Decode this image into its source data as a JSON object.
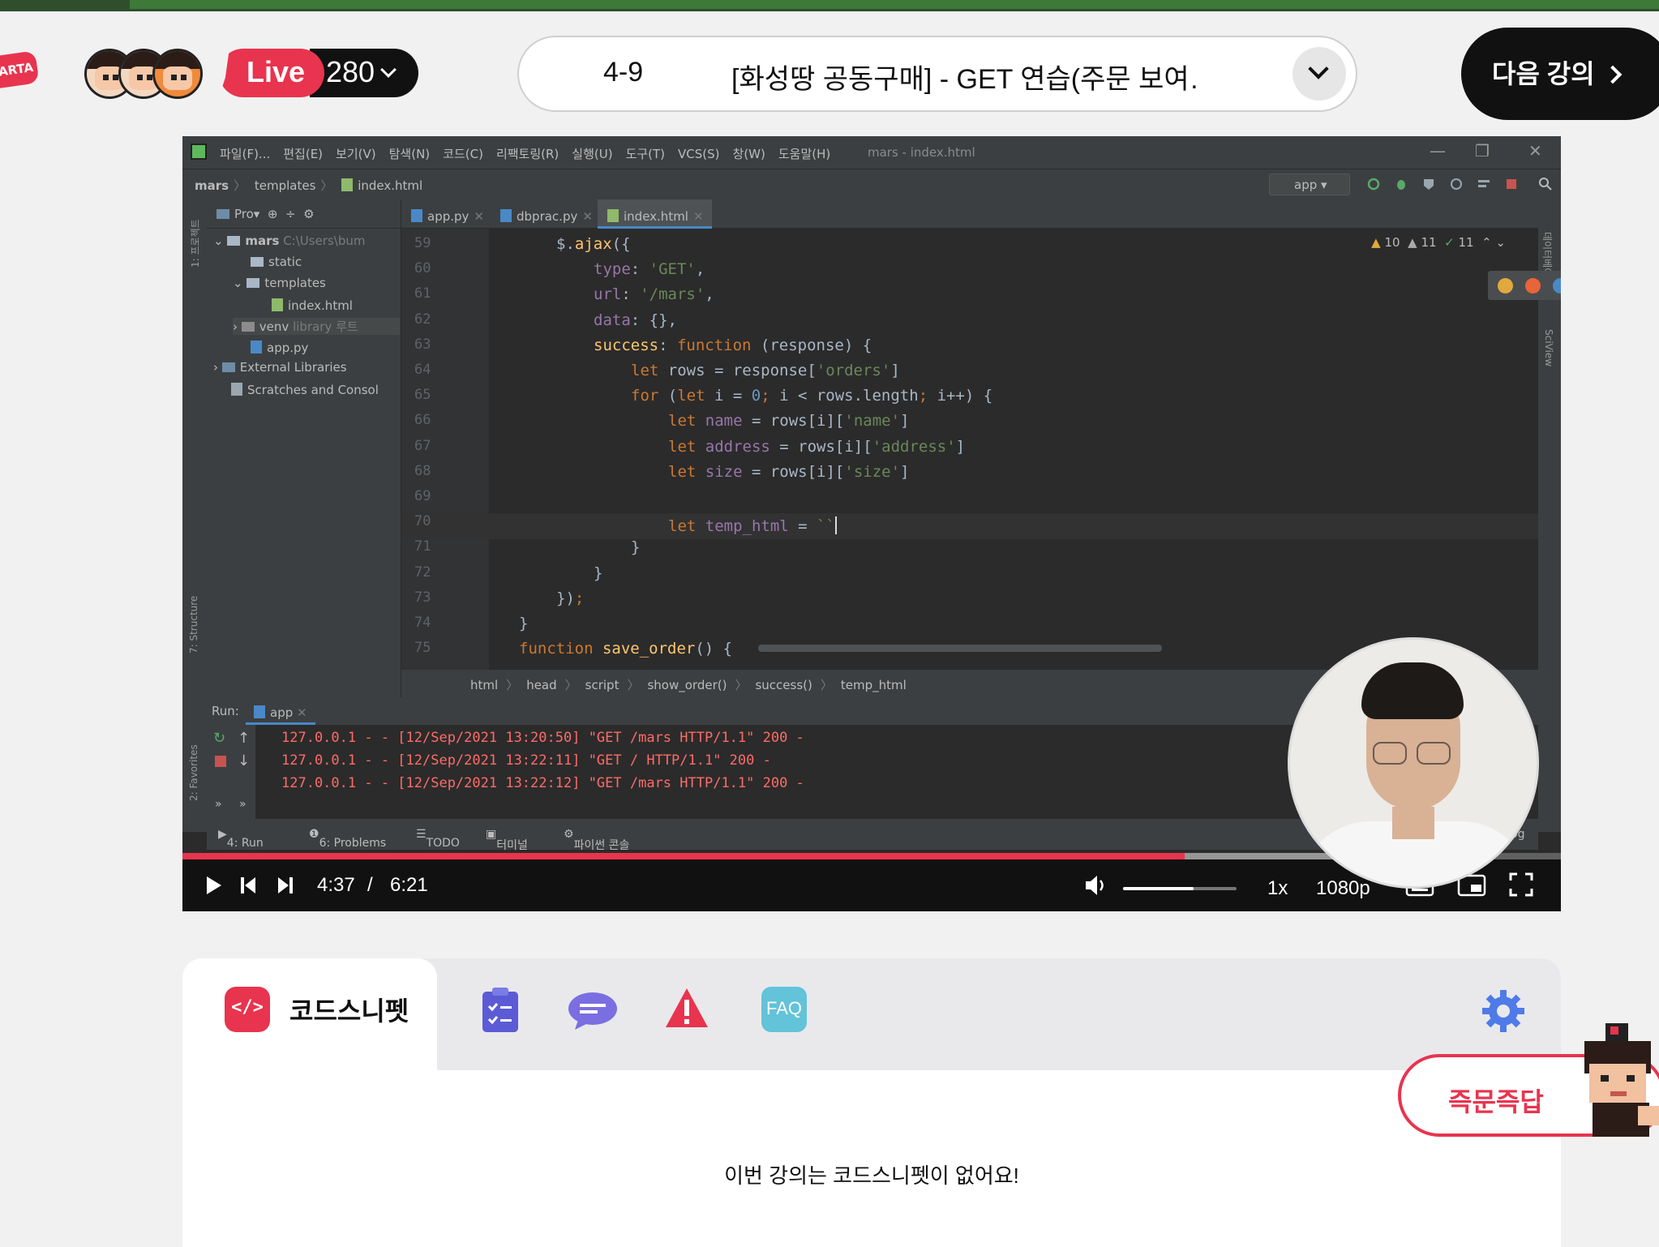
{
  "header": {
    "logo_text": "ARTA",
    "live_label": "Live",
    "live_count": "280",
    "lecture_number": "4-9",
    "lecture_title": "[화성땅 공동구매] - GET 연습(주문 보여…",
    "next_button": "다음 강의"
  },
  "ide": {
    "menus": [
      "파일(F)...",
      "편집(E)",
      "보기(V)",
      "탐색(N)",
      "코드(C)",
      "리팩토링(R)",
      "실행(U)",
      "도구(T)",
      "VCS(S)",
      "창(W)",
      "도움말(H)"
    ],
    "window_title": "mars - index.html",
    "breadcrumbs": [
      "mars",
      "templates",
      "index.html"
    ],
    "run_config": "app",
    "project": {
      "header": "Pro",
      "items": [
        {
          "label": "mars",
          "extra": "C:\\Users\\bum"
        },
        {
          "label": "static",
          "extra": ""
        },
        {
          "label": "templates",
          "extra": ""
        },
        {
          "label": "index.html",
          "extra": ""
        },
        {
          "label": "venv",
          "extra": "library 루트"
        },
        {
          "label": "app.py",
          "extra": ""
        },
        {
          "label": "External Libraries",
          "extra": ""
        },
        {
          "label": "Scratches and Consol",
          "extra": ""
        }
      ]
    },
    "left_stripe": [
      "1: 프로젝트",
      "7: Structure",
      "2: Favorites"
    ],
    "right_stripe": [
      "데이터베이스",
      "SciView"
    ],
    "tabs": [
      "app.py",
      "dbprac.py",
      "index.html"
    ],
    "inspections": {
      "warnings": "10",
      "weak": "11",
      "ok": "11"
    },
    "code_lines": [
      {
        "n": "59",
        "segs": [
          [
            "plain",
            "$."
          ],
          [
            "fn",
            "ajax"
          ],
          [
            "plain",
            "({"
          ]
        ],
        "indent": 2
      },
      {
        "n": "60",
        "segs": [
          [
            "prop",
            "type"
          ],
          [
            "plain",
            ": "
          ],
          [
            "str",
            "'GET'"
          ],
          [
            "plain",
            ","
          ]
        ],
        "indent": 3
      },
      {
        "n": "61",
        "segs": [
          [
            "prop",
            "url"
          ],
          [
            "plain",
            ": "
          ],
          [
            "str",
            "'/mars'"
          ],
          [
            "plain",
            ","
          ]
        ],
        "indent": 3
      },
      {
        "n": "62",
        "segs": [
          [
            "prop",
            "data"
          ],
          [
            "plain",
            ": {},"
          ]
        ],
        "indent": 3
      },
      {
        "n": "63",
        "segs": [
          [
            "fn",
            "success"
          ],
          [
            "plain",
            ": "
          ],
          [
            "kw",
            "function "
          ],
          [
            "plain",
            "(response) {"
          ]
        ],
        "indent": 3
      },
      {
        "n": "64",
        "segs": [
          [
            "kw",
            "let "
          ],
          [
            "plain",
            "rows = response["
          ],
          [
            "str",
            "'orders'"
          ],
          [
            "plain",
            "]"
          ]
        ],
        "indent": 4
      },
      {
        "n": "65",
        "segs": [
          [
            "kw",
            "for "
          ],
          [
            "plain",
            "("
          ],
          [
            "kw",
            "let "
          ],
          [
            "plain",
            "i = "
          ],
          [
            "num",
            "0"
          ],
          [
            "kw",
            "; "
          ],
          [
            "plain",
            "i < rows.length"
          ],
          [
            "kw",
            "; "
          ],
          [
            "plain",
            "i++) {"
          ]
        ],
        "indent": 4
      },
      {
        "n": "66",
        "segs": [
          [
            "kw",
            "let "
          ],
          [
            "prop",
            "name"
          ],
          [
            "plain",
            " = rows[i]["
          ],
          [
            "str",
            "'name'"
          ],
          [
            "plain",
            "]"
          ]
        ],
        "indent": 5
      },
      {
        "n": "67",
        "segs": [
          [
            "kw",
            "let "
          ],
          [
            "prop",
            "address"
          ],
          [
            "plain",
            " = rows[i]["
          ],
          [
            "str",
            "'address'"
          ],
          [
            "plain",
            "]"
          ]
        ],
        "indent": 5
      },
      {
        "n": "68",
        "segs": [
          [
            "kw",
            "let "
          ],
          [
            "prop",
            "size"
          ],
          [
            "plain",
            " = rows[i]["
          ],
          [
            "str",
            "'size'"
          ],
          [
            "plain",
            "]"
          ]
        ],
        "indent": 5
      },
      {
        "n": "69",
        "segs": [],
        "indent": 0
      },
      {
        "n": "70",
        "segs": [
          [
            "kw",
            "let "
          ],
          [
            "prop",
            "temp_html"
          ],
          [
            "plain",
            " = "
          ],
          [
            "str",
            "``"
          ]
        ],
        "indent": 5,
        "cursor": true
      },
      {
        "n": "71",
        "segs": [
          [
            "plain",
            "}"
          ]
        ],
        "indent": 4
      },
      {
        "n": "72",
        "segs": [
          [
            "plain",
            "}"
          ]
        ],
        "indent": 3
      },
      {
        "n": "73",
        "segs": [
          [
            "plain",
            "})"
          ],
          [
            "kw",
            ";"
          ]
        ],
        "indent": 2
      },
      {
        "n": "74",
        "segs": [
          [
            "plain",
            "}"
          ]
        ],
        "indent": 1
      },
      {
        "n": "75",
        "segs": [
          [
            "kw",
            "function "
          ],
          [
            "fn",
            "save_order"
          ],
          [
            "plain",
            "() {"
          ]
        ],
        "indent": 1
      }
    ],
    "code_breadcrumbs": [
      "html",
      "head",
      "script",
      "show_order()",
      "success()",
      "temp_html"
    ],
    "run": {
      "label": "Run:",
      "tab": "app",
      "log": [
        "127.0.0.1 - - [12/Sep/2021 13:20:50] \"GET /mars HTTP/1.1\" 200 -",
        "127.0.0.1 - - [12/Sep/2021 13:22:11] \"GET / HTTP/1.1\" 200 -",
        "127.0.0.1 - - [12/Sep/2021 13:22:12] \"GET /mars HTTP/1.1\" 200 -"
      ]
    },
    "bottom_tools": [
      "4: Run",
      "6: Problems",
      "TODO",
      "터미널",
      "파이썬 콘솔",
      "og"
    ]
  },
  "player": {
    "current_time": "4:37",
    "separator": "/",
    "duration": "6:21",
    "progress": 0.727,
    "buffered": 0.87,
    "volume": 0.62,
    "speed": "1x",
    "quality": "1080p"
  },
  "panel": {
    "active_tab": "코드스니펫",
    "snippet_icon": "</>",
    "faq_label": "FAQ",
    "empty_message": "이번 강의는 코드스니펫이 없어요!",
    "qa_button": "즉문즉답"
  },
  "colors": {
    "brand": "#e8344e",
    "faq": "#62c3d9",
    "notes": "#5b5bd6",
    "gear": "#4f7be8"
  }
}
